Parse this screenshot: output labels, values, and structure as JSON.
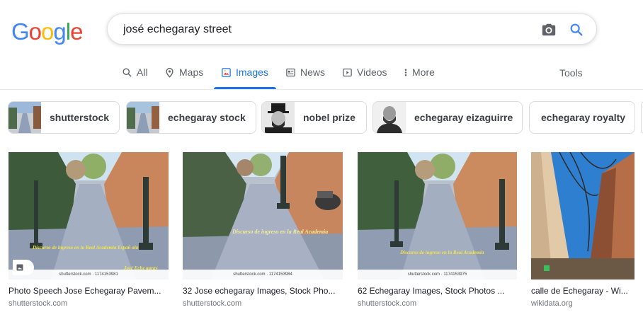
{
  "logo": {
    "letters": [
      "G",
      "o",
      "o",
      "g",
      "l",
      "e"
    ]
  },
  "search": {
    "query": "josé echegaray street"
  },
  "tabs": [
    {
      "label": "All"
    },
    {
      "label": "Maps"
    },
    {
      "label": "Images"
    },
    {
      "label": "News"
    },
    {
      "label": "Videos"
    },
    {
      "label": "More"
    }
  ],
  "tools_label": "Tools",
  "chips": [
    {
      "label": "shutterstock"
    },
    {
      "label": "echegaray stock"
    },
    {
      "label": "nobel prize"
    },
    {
      "label": "echegaray eizaguirre"
    },
    {
      "label": "echegaray royalty"
    }
  ],
  "results": [
    {
      "title": "Photo Speech Jose Echegaray Pavem...",
      "site": "shutterstock.com",
      "watermark": "shutterstock.com · 1174153981",
      "overlay_line1": "Discurso de ingreso en la Real Academia Españ ola",
      "overlay_line2": "José Eche garay"
    },
    {
      "title": "32 Jose echegaray Images, Stock Pho...",
      "site": "shutterstock.com",
      "watermark": "shutterstock.com · 1174153984",
      "overlay_line1": "Discurso de ingreso en la Real Academia"
    },
    {
      "title": "62 Echegaray Images, Stock Photos ...",
      "site": "shutterstock.com",
      "watermark": "shutterstock.com · 1174153975",
      "overlay_line1": "Discurso de ingreso en la Real Academia"
    },
    {
      "title": "calle de Echegaray - Wi...",
      "site": "wikidata.org"
    }
  ],
  "colors": {
    "accent": "#1a73e8",
    "muted": "#5f6368"
  }
}
